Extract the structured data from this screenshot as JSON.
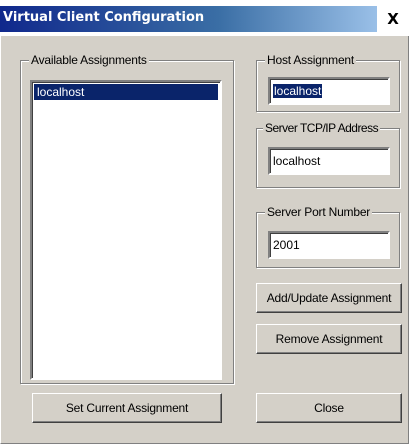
{
  "window": {
    "title": "Virtual Client Configuration",
    "close_glyph": "X"
  },
  "available": {
    "label": "Available Assignments",
    "items": [
      "localhost"
    ],
    "selected_index": 0
  },
  "host": {
    "label": "Host Assignment",
    "value": "localhost"
  },
  "server_address": {
    "label": "Server TCP/IP Address",
    "value": "localhost"
  },
  "server_port": {
    "label": "Server Port Number",
    "value": "2001"
  },
  "buttons": {
    "add_update": "Add/Update Assignment",
    "remove": "Remove Assignment",
    "set_current": "Set Current Assignment",
    "close": "Close"
  },
  "colors": {
    "face": "#d4d0c8",
    "selection": "#0a246a",
    "title_start": "#10288c",
    "title_end": "#a6caf0"
  }
}
